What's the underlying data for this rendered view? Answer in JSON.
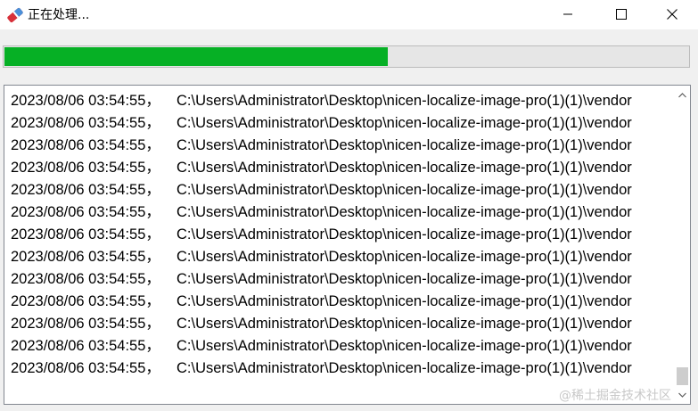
{
  "window": {
    "title": "正在处理...",
    "icon": "eraser-icon",
    "buttons": {
      "minimize": "minimize-icon",
      "maximize": "maximize-icon",
      "close": "close-icon"
    }
  },
  "progress": {
    "value_fraction": 0.56,
    "fill_color": "#06b025"
  },
  "log": {
    "lines": [
      {
        "timestamp": "2023/08/06 03:54:55，",
        "path": "C:\\Users\\Administrator\\Desktop\\nicen-localize-image-pro(1)(1)\\vendor"
      },
      {
        "timestamp": "2023/08/06 03:54:55，",
        "path": "C:\\Users\\Administrator\\Desktop\\nicen-localize-image-pro(1)(1)\\vendor"
      },
      {
        "timestamp": "2023/08/06 03:54:55，",
        "path": "C:\\Users\\Administrator\\Desktop\\nicen-localize-image-pro(1)(1)\\vendor"
      },
      {
        "timestamp": "2023/08/06 03:54:55，",
        "path": "C:\\Users\\Administrator\\Desktop\\nicen-localize-image-pro(1)(1)\\vendor"
      },
      {
        "timestamp": "2023/08/06 03:54:55，",
        "path": "C:\\Users\\Administrator\\Desktop\\nicen-localize-image-pro(1)(1)\\vendor"
      },
      {
        "timestamp": "2023/08/06 03:54:55，",
        "path": "C:\\Users\\Administrator\\Desktop\\nicen-localize-image-pro(1)(1)\\vendor"
      },
      {
        "timestamp": "2023/08/06 03:54:55，",
        "path": "C:\\Users\\Administrator\\Desktop\\nicen-localize-image-pro(1)(1)\\vendor"
      },
      {
        "timestamp": "2023/08/06 03:54:55，",
        "path": "C:\\Users\\Administrator\\Desktop\\nicen-localize-image-pro(1)(1)\\vendor"
      },
      {
        "timestamp": "2023/08/06 03:54:55，",
        "path": "C:\\Users\\Administrator\\Desktop\\nicen-localize-image-pro(1)(1)\\vendor"
      },
      {
        "timestamp": "2023/08/06 03:54:55，",
        "path": "C:\\Users\\Administrator\\Desktop\\nicen-localize-image-pro(1)(1)\\vendor"
      },
      {
        "timestamp": "2023/08/06 03:54:55，",
        "path": "C:\\Users\\Administrator\\Desktop\\nicen-localize-image-pro(1)(1)\\vendor"
      },
      {
        "timestamp": "2023/08/06 03:54:55，",
        "path": "C:\\Users\\Administrator\\Desktop\\nicen-localize-image-pro(1)(1)\\vendor"
      },
      {
        "timestamp": "2023/08/06 03:54:55，",
        "path": "C:\\Users\\Administrator\\Desktop\\nicen-localize-image-pro(1)(1)\\vendor"
      }
    ]
  },
  "watermark": "@稀土掘金技术社区"
}
